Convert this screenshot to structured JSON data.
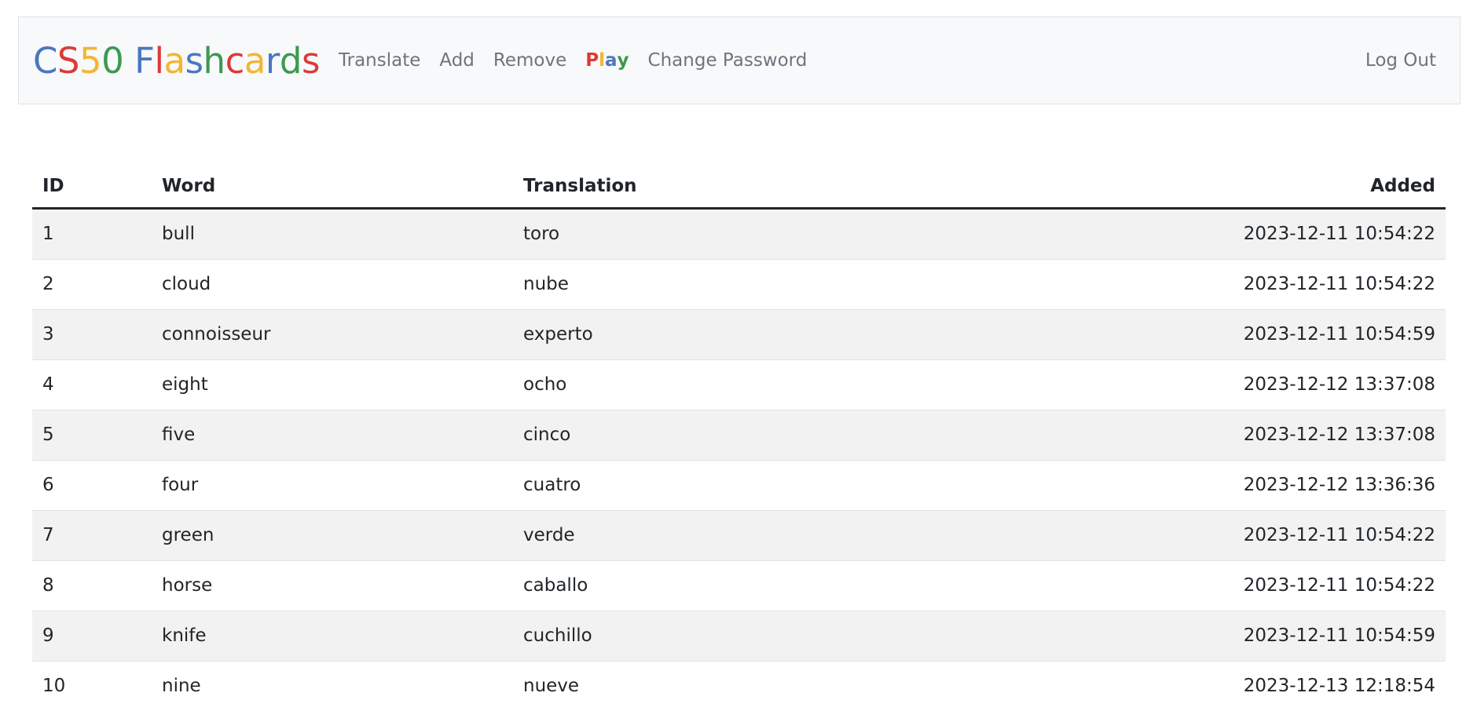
{
  "brand": {
    "letters": [
      {
        "ch": "C",
        "color": "#4a77c0"
      },
      {
        "ch": "S",
        "color": "#dc3a3a"
      },
      {
        "ch": "5",
        "color": "#f2b632"
      },
      {
        "ch": "0",
        "color": "#3a9a4e"
      },
      {
        "ch": " ",
        "color": "#000000"
      },
      {
        "ch": "F",
        "color": "#4a77c0"
      },
      {
        "ch": "l",
        "color": "#dc3a3a"
      },
      {
        "ch": "a",
        "color": "#f2b632"
      },
      {
        "ch": "s",
        "color": "#4a77c0"
      },
      {
        "ch": "h",
        "color": "#3a9a4e"
      },
      {
        "ch": "c",
        "color": "#dc3a3a"
      },
      {
        "ch": "a",
        "color": "#f2b632"
      },
      {
        "ch": "r",
        "color": "#4a77c0"
      },
      {
        "ch": "d",
        "color": "#3a9a4e"
      },
      {
        "ch": "s",
        "color": "#dc3a3a"
      }
    ]
  },
  "nav": {
    "translate": "Translate",
    "add": "Add",
    "remove": "Remove",
    "play_letters": [
      {
        "ch": "P",
        "color": "#dc3a3a"
      },
      {
        "ch": "l",
        "color": "#f2b632"
      },
      {
        "ch": "a",
        "color": "#4a77c0"
      },
      {
        "ch": "y",
        "color": "#3a9a4e"
      }
    ],
    "change_password": "Change Password",
    "logout": "Log Out"
  },
  "table": {
    "headers": {
      "id": "ID",
      "word": "Word",
      "translation": "Translation",
      "added": "Added"
    },
    "rows": [
      {
        "id": "1",
        "word": "bull",
        "translation": "toro",
        "added": "2023-12-11 10:54:22"
      },
      {
        "id": "2",
        "word": "cloud",
        "translation": "nube",
        "added": "2023-12-11 10:54:22"
      },
      {
        "id": "3",
        "word": "connoisseur",
        "translation": "experto",
        "added": "2023-12-11 10:54:59"
      },
      {
        "id": "4",
        "word": "eight",
        "translation": "ocho",
        "added": "2023-12-12 13:37:08"
      },
      {
        "id": "5",
        "word": "five",
        "translation": "cinco",
        "added": "2023-12-12 13:37:08"
      },
      {
        "id": "6",
        "word": "four",
        "translation": "cuatro",
        "added": "2023-12-12 13:36:36"
      },
      {
        "id": "7",
        "word": "green",
        "translation": "verde",
        "added": "2023-12-11 10:54:22"
      },
      {
        "id": "8",
        "word": "horse",
        "translation": "caballo",
        "added": "2023-12-11 10:54:22"
      },
      {
        "id": "9",
        "word": "knife",
        "translation": "cuchillo",
        "added": "2023-12-11 10:54:59"
      },
      {
        "id": "10",
        "word": "nine",
        "translation": "nueve",
        "added": "2023-12-13 12:18:54"
      }
    ]
  }
}
